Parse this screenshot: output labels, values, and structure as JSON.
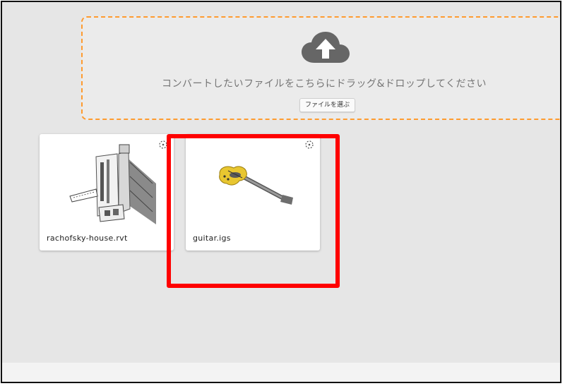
{
  "dropzone": {
    "icon": "cloud-upload-icon",
    "message": "コンバートしたいファイルをこちらにドラッグ&ドロップしてください",
    "select_button": "ファイルを選ぶ"
  },
  "files": [
    {
      "name": "rachofsky-house.rvt",
      "thumbnail": "building-model"
    },
    {
      "name": "guitar.igs",
      "thumbnail": "guitar-model"
    }
  ],
  "colors": {
    "dropzone_border": "#ff9b2f",
    "highlight": "#ff0000",
    "background": "#e6e6e6",
    "icon": "#666666"
  }
}
